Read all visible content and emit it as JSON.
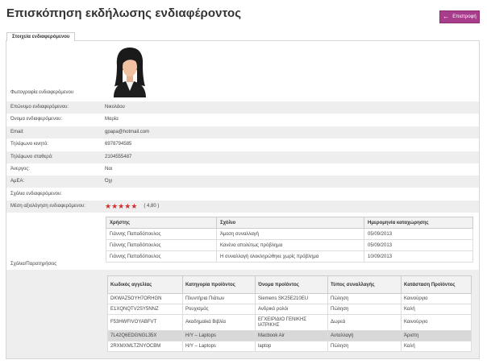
{
  "page": {
    "title": "Επισκόπηση εκδήλωσης ενδιαφέροντος"
  },
  "header": {
    "back_label": "Επιστροφή",
    "accent": "#a83d8b"
  },
  "tab": {
    "label": "Στοιχεία ενδιαφερόμενου"
  },
  "profile": {
    "photo_label": "Φωτογραφία ενδιαφερόμενου",
    "fields": [
      {
        "label": "Επώνυμο ενδιαφερόμενου:",
        "value": "Νικολάου"
      },
      {
        "label": "Όνομα ενδιαφερόμενου:",
        "value": "Μαρία"
      },
      {
        "label": "Email:",
        "value": "gpapa@hotmail.com"
      },
      {
        "label": "Τηλέφωνο κινητό:",
        "value": "6978794585"
      },
      {
        "label": "Τηλέφωνο σταθερό:",
        "value": "2104555487"
      },
      {
        "label": "Άνεργος:",
        "value": "Ναι"
      },
      {
        "label": "ΑμΕΑ:",
        "value": "Όχι"
      },
      {
        "label": "Σχόλια ενδιαφερόμενου:",
        "value": ""
      }
    ],
    "rating_label": "Μέση αξιολόγηση ενδιαφερόμενου:",
    "rating_value": "( 4,80 )",
    "rating_stars": 5,
    "star_color": "#d42f2f"
  },
  "comments": {
    "label": "Σχόλια/Παρατηρήσεις",
    "headers": [
      "Χρήστης",
      "Σχόλιο",
      "Ημερομηνία καταχώρησης"
    ],
    "rows": [
      [
        "Γιάννης Παπαδόπουλος",
        "Άμεση συναλλαγή",
        "05/09/2013"
      ],
      [
        "Γιάννης Παπαδόπουλος",
        "Κανένα απολύτως πρόβλημα",
        "05/09/2013"
      ],
      [
        "Γιάννης Παπαδόπουλος",
        "Η συναλλαγή ολοκληρώθηκε χωρίς πρόβλημα",
        "10/09/2013"
      ]
    ]
  },
  "ads": {
    "headers": [
      "Κωδικός αγγελίας",
      "Κατηγορία προϊόντος",
      "Όνομα προϊόντος",
      "Τύπος συναλλαγής",
      "Κατάσταση Προϊόντος"
    ],
    "rows": [
      [
        "DKWAZ5OYH7ORHGN",
        "Πλυντήρια Πιάτων",
        "Siemens SK25E210EU",
        "Πώληση",
        "Καινούργιο"
      ],
      [
        "E1XQNQTV2SY5NNZ",
        "Ρουχισμός",
        "Ανδρικό ρολόι",
        "Πώληση",
        "Καλή"
      ],
      [
        "F53HWFIVOYABFVT",
        "Ακαδημαϊκά Βιβλία",
        "ΕΓΧΕΙΡΙΔΙΟ ΓΕΝΙΚΗΣ ΙΑΤΡΙΚΗΣ",
        "Δωρεά",
        "Καινούργιο"
      ],
      [
        "7L42Q6EDGNGL35X",
        "Η/Υ – Laptops",
        "Macbook Air",
        "Ανταλλαγή",
        "Άριστη"
      ],
      [
        "2RXMXMLTZNYOCBM",
        "Η/Υ – Laptops",
        "laptop",
        "Πώληση",
        "Καλή"
      ]
    ]
  }
}
